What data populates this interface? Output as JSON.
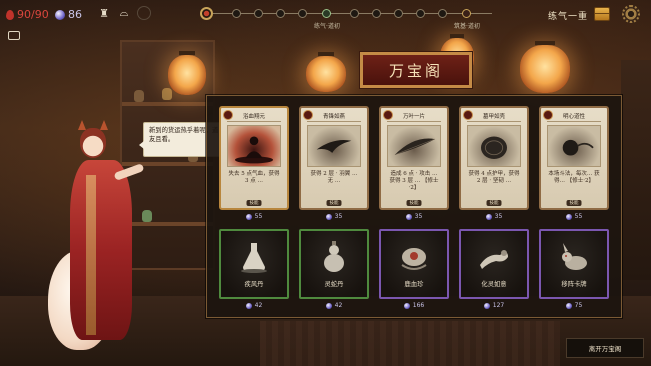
{
  "hud": {
    "hp": "90/90",
    "mana": "86",
    "colors": {
      "hp": "#d9463d",
      "mana": "#c9c4e8"
    },
    "icons": [
      "potion-icon",
      "hat-icon",
      "empty-slot-icon"
    ],
    "progress": {
      "labels": [
        "练气·道初",
        "筑基·道初"
      ]
    },
    "realm_label": "练气一重"
  },
  "merchant": {
    "speech": "新到的货运热乎着呢，道友且看。"
  },
  "shop": {
    "title": "万宝阁",
    "cards": [
      {
        "name": "浴血翔元",
        "desc": "失去 5 点气血，获得 3 点 …",
        "type": "技能",
        "price": "55",
        "art": "red"
      },
      {
        "name": "青锋如燕",
        "desc": "获得 2 层 · 羽翼 … 无 …",
        "type": "技能",
        "price": "35",
        "art": "bird"
      },
      {
        "name": "万叶一片",
        "desc": "造成 6 点 · 攻击 … 获得 3 层 … 【修士·2】",
        "type": "技能",
        "price": "35",
        "art": "leaf"
      },
      {
        "name": "墓甲如壳",
        "desc": "获得 4 点护甲，获得 2 层 · 坚韧 …",
        "type": "技能",
        "price": "35",
        "art": "shell"
      },
      {
        "name": "明心道性",
        "desc": "本场斗法，每次… 获得… 【修士·2】",
        "type": "技能",
        "price": "55",
        "art": "orb"
      }
    ],
    "items": [
      {
        "name": "疾风丹",
        "price": "42",
        "rarity": "green",
        "art": "flask"
      },
      {
        "name": "灵蛇丹",
        "price": "42",
        "rarity": "green",
        "art": "gourd"
      },
      {
        "name": "鹿血珍",
        "price": "166",
        "rarity": "purple",
        "art": "dragon"
      },
      {
        "name": "化灵如意",
        "price": "127",
        "rarity": "purple",
        "art": "ruyi"
      },
      {
        "name": "移阵卡牌",
        "price": "75",
        "rarity": "purple",
        "art": "rabbit"
      }
    ]
  },
  "leave_label": "离开万宝阁"
}
